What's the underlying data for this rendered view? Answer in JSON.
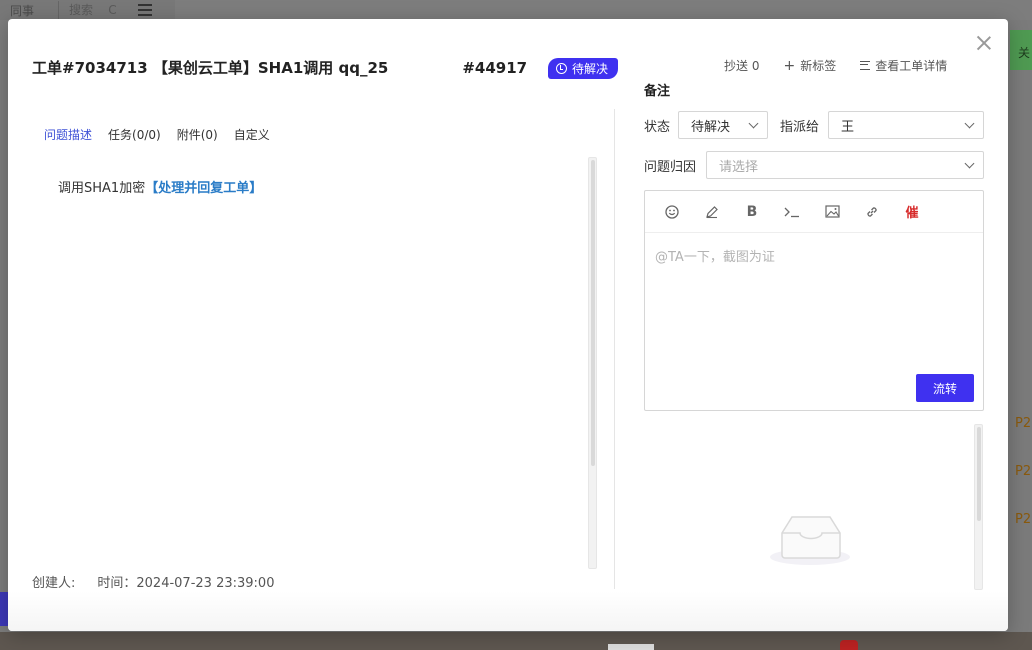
{
  "background": {
    "topbar_colleague": "同事",
    "topbar_search": "搜索",
    "topbar_search_key": "C",
    "right_button": "关",
    "priority_labels": [
      "P2",
      "P2",
      "P2"
    ]
  },
  "ticket": {
    "title": "工单#7034713 【果创云工单】SHA1调用 qq_25",
    "title_suffix": "#44917",
    "status_badge": "待解决"
  },
  "top_actions": {
    "cc": "抄送 0",
    "new_tag": "新标签",
    "view_detail": "查看工单详情"
  },
  "tabs": [
    {
      "label": "问题描述",
      "active": true
    },
    {
      "label": "任务(0/0)",
      "active": false
    },
    {
      "label": "附件(0)",
      "active": false
    },
    {
      "label": "自定义",
      "active": false
    }
  ],
  "description": {
    "text": "调用SHA1加密",
    "link": "【处理并回复工单】"
  },
  "footer": {
    "creator_label": "创建人:",
    "time": "时间：2024-07-23 23:39:00"
  },
  "notes": {
    "label": "备注",
    "status_label": "状态",
    "status_value": "待解决",
    "assign_label": "指派给",
    "assign_value": "王",
    "cause_label": "问题归因",
    "cause_placeholder": "请选择",
    "editor_placeholder": "@TA一下，截图为证",
    "urge_label": "催",
    "submit_label": "流转"
  },
  "colors": {
    "accent": "#3f31f0",
    "link": "#2a7cc7",
    "active_tab": "#3f52d6",
    "urge": "#d72b2b"
  }
}
